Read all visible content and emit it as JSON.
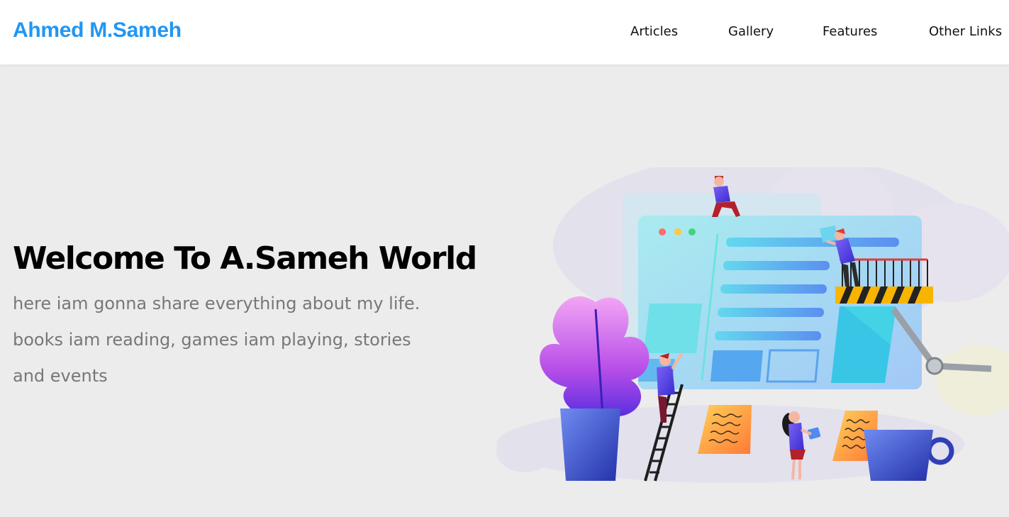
{
  "header": {
    "logo": "Ahmed M.Sameh",
    "nav": [
      "Articles",
      "Gallery",
      "Features",
      "Other Links"
    ]
  },
  "landing": {
    "title": "Welcome To A.Sameh World",
    "description": "here iam gonna share everything about my life. books iam reading, games iam playing, stories and events"
  },
  "colors": {
    "brand": "#2196f3",
    "page_background": "#ececec",
    "header_background": "#ffffff",
    "description_text": "#777777"
  }
}
